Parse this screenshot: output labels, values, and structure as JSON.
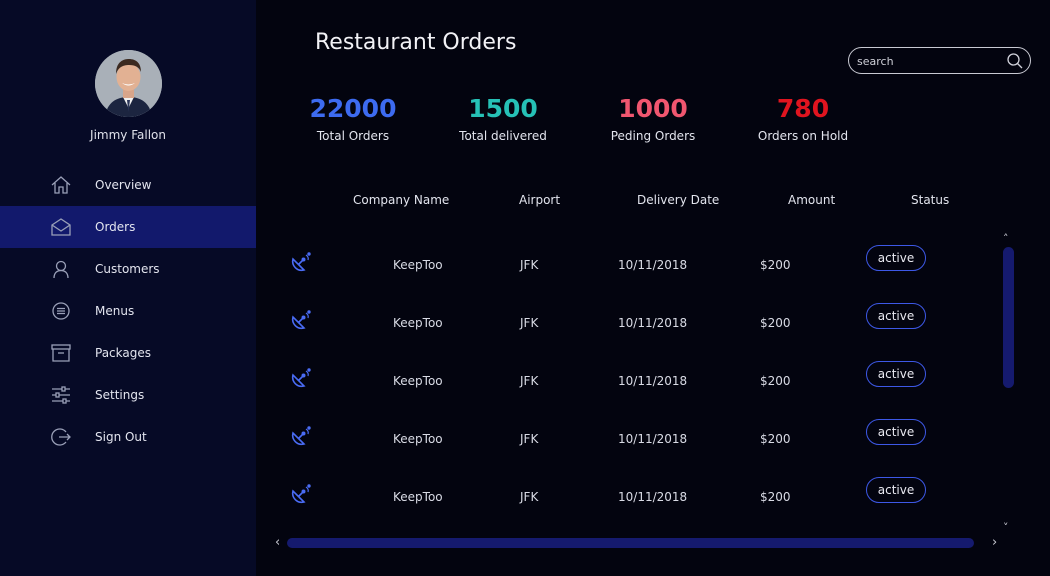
{
  "user": {
    "name": "Jimmy Fallon"
  },
  "nav": [
    {
      "label": "Overview",
      "icon": "home-icon",
      "active": false
    },
    {
      "label": "Orders",
      "icon": "mail-icon",
      "active": true
    },
    {
      "label": "Customers",
      "icon": "person-icon",
      "active": false
    },
    {
      "label": "Menus",
      "icon": "list-circle-icon",
      "active": false
    },
    {
      "label": "Packages",
      "icon": "archive-icon",
      "active": false
    },
    {
      "label": "Settings",
      "icon": "sliders-icon",
      "active": false
    },
    {
      "label": "Sign Out",
      "icon": "sign-out-icon",
      "active": false
    }
  ],
  "page": {
    "title": "Restaurant Orders"
  },
  "search": {
    "placeholder": "search",
    "value": ""
  },
  "stats": [
    {
      "value": "22000",
      "label": "Total Orders",
      "color": "#3d6bf0"
    },
    {
      "value": "1500",
      "label": "Total delivered",
      "color": "#26c1b6"
    },
    {
      "value": "1000",
      "label": "Peding Orders",
      "color": "#f0566f"
    },
    {
      "value": "780",
      "label": "Orders on Hold",
      "color": "#e0141f"
    }
  ],
  "table": {
    "columns": [
      "Company Name",
      "Airport",
      "Delivery Date",
      "Amount",
      "Status"
    ],
    "rows": [
      {
        "icon": "satellite-dish-icon",
        "company": "KeepToo",
        "airport": "JFK",
        "date": "10/11/2018",
        "amount": "$200",
        "status": "active"
      },
      {
        "icon": "satellite-dish-icon",
        "company": "KeepToo",
        "airport": "JFK",
        "date": "10/11/2018",
        "amount": "$200",
        "status": "active"
      },
      {
        "icon": "satellite-dish-icon",
        "company": "KeepToo",
        "airport": "JFK",
        "date": "10/11/2018",
        "amount": "$200",
        "status": "active"
      },
      {
        "icon": "satellite-dish-icon",
        "company": "KeepToo",
        "airport": "JFK",
        "date": "10/11/2018",
        "amount": "$200",
        "status": "active"
      },
      {
        "icon": "satellite-dish-icon",
        "company": "KeepToo",
        "airport": "JFK",
        "date": "10/11/2018",
        "amount": "$200",
        "status": "active"
      }
    ]
  },
  "colors": {
    "sidebar": "#060a26",
    "active_nav": "#12196c",
    "accent": "#3d58e6",
    "background": "#03040f"
  }
}
